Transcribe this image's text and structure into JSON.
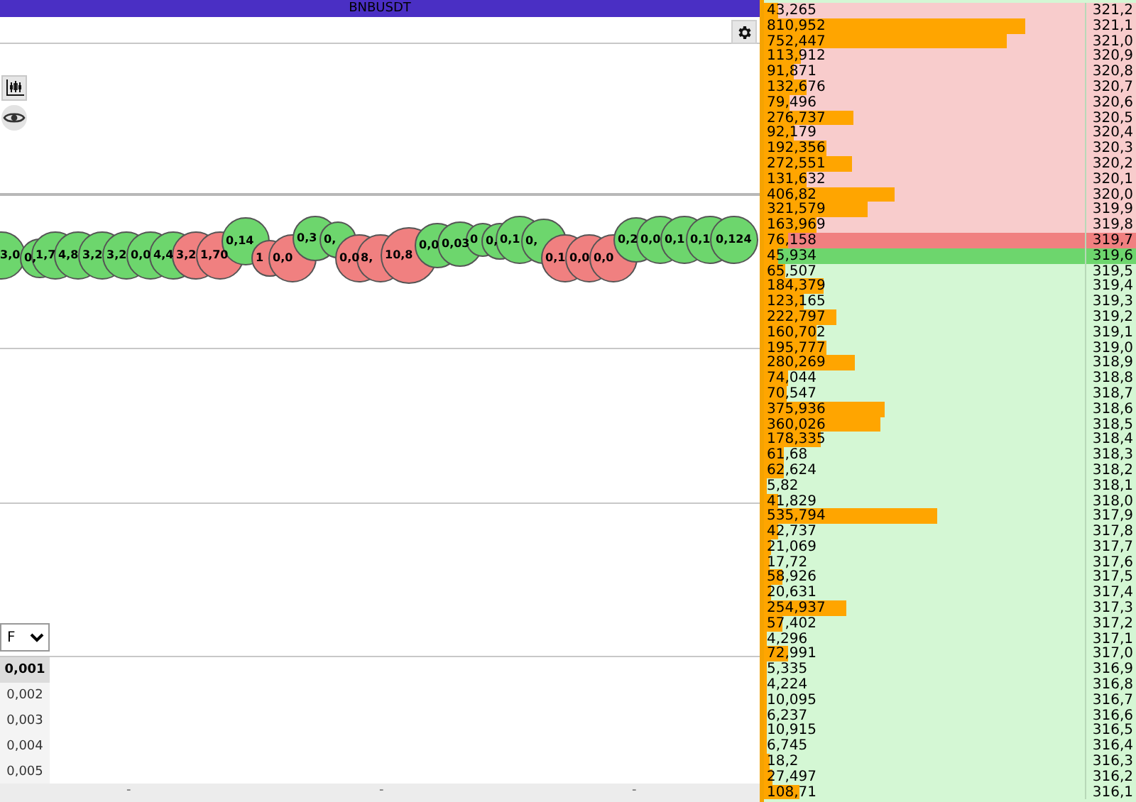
{
  "title": "BNBUSDT",
  "trades": [
    {
      "label": "3,0",
      "kind": "buy"
    },
    {
      "label": "0,",
      "kind": "buy"
    },
    {
      "label": "1,7",
      "kind": "buy"
    },
    {
      "label": "4,8",
      "kind": "buy"
    },
    {
      "label": "3,2",
      "kind": "buy"
    },
    {
      "label": "3,2",
      "kind": "buy"
    },
    {
      "label": "0,0",
      "kind": "buy"
    },
    {
      "label": "4,4",
      "kind": "buy"
    },
    {
      "label": "3,2",
      "kind": "sell"
    },
    {
      "label": "1,70",
      "kind": "sell"
    },
    {
      "label": "0,14",
      "kind": "buy"
    },
    {
      "label": "1",
      "kind": "sell"
    },
    {
      "label": "0,0",
      "kind": "sell"
    },
    {
      "label": "0,3",
      "kind": "buy"
    },
    {
      "label": "0,",
      "kind": "buy"
    },
    {
      "label": "0,0",
      "kind": "sell"
    },
    {
      "label": "8,",
      "kind": "sell"
    },
    {
      "label": "10,8",
      "kind": "sell"
    },
    {
      "label": "0,0",
      "kind": "buy"
    },
    {
      "label": "0,03",
      "kind": "buy"
    },
    {
      "label": "0",
      "kind": "buy"
    },
    {
      "label": "0,",
      "kind": "buy"
    },
    {
      "label": "0,1",
      "kind": "buy"
    },
    {
      "label": "0,",
      "kind": "buy"
    },
    {
      "label": "0,1",
      "kind": "sell"
    },
    {
      "label": "0,0",
      "kind": "sell"
    },
    {
      "label": "0,0",
      "kind": "sell"
    },
    {
      "label": "0,2",
      "kind": "buy"
    },
    {
      "label": "0,0",
      "kind": "buy"
    },
    {
      "label": "0,1",
      "kind": "buy"
    },
    {
      "label": "0,1",
      "kind": "buy"
    },
    {
      "label": "0,124",
      "kind": "buy"
    }
  ],
  "filter": {
    "value": "F"
  },
  "steps": [
    {
      "label": "0,001",
      "selected": true
    },
    {
      "label": "0,002",
      "selected": false
    },
    {
      "label": "0,003",
      "selected": false
    },
    {
      "label": "0,004",
      "selected": false
    },
    {
      "label": "0,005",
      "selected": false
    }
  ],
  "axis_labels": [
    "-",
    "-",
    "-"
  ],
  "order_book": [
    {
      "qty": "43,265",
      "price": "321,2",
      "level": 0.043,
      "kind": "ask"
    },
    {
      "qty": "810,952",
      "price": "321,1",
      "level": 0.811,
      "kind": "ask"
    },
    {
      "qty": "752,447",
      "price": "321,0",
      "level": 0.752,
      "kind": "ask"
    },
    {
      "qty": "113,912",
      "price": "320,9",
      "level": 0.114,
      "kind": "ask"
    },
    {
      "qty": "91,871",
      "price": "320,8",
      "level": 0.092,
      "kind": "ask"
    },
    {
      "qty": "132,676",
      "price": "320,7",
      "level": 0.133,
      "kind": "ask"
    },
    {
      "qty": "79,496",
      "price": "320,6",
      "level": 0.079,
      "kind": "ask"
    },
    {
      "qty": "276,737",
      "price": "320,5",
      "level": 0.277,
      "kind": "ask"
    },
    {
      "qty": "92,179",
      "price": "320,4",
      "level": 0.092,
      "kind": "ask"
    },
    {
      "qty": "192,356",
      "price": "320,3",
      "level": 0.192,
      "kind": "ask"
    },
    {
      "qty": "272,551",
      "price": "320,2",
      "level": 0.273,
      "kind": "ask"
    },
    {
      "qty": "131,632",
      "price": "320,1",
      "level": 0.132,
      "kind": "ask"
    },
    {
      "qty": "406,82",
      "price": "320,0",
      "level": 0.407,
      "kind": "ask"
    },
    {
      "qty": "321,579",
      "price": "319,9",
      "level": 0.322,
      "kind": "ask"
    },
    {
      "qty": "163,969",
      "price": "319,8",
      "level": 0.164,
      "kind": "ask"
    },
    {
      "qty": "76,158",
      "price": "319,7",
      "level": 0.076,
      "kind": "best_ask"
    },
    {
      "qty": "45,934",
      "price": "319,6",
      "level": 0.046,
      "kind": "best_bid"
    },
    {
      "qty": "65,507",
      "price": "319,5",
      "level": 0.066,
      "kind": "bid"
    },
    {
      "qty": "184,379",
      "price": "319,4",
      "level": 0.184,
      "kind": "bid"
    },
    {
      "qty": "123,165",
      "price": "319,3",
      "level": 0.123,
      "kind": "bid"
    },
    {
      "qty": "222,797",
      "price": "319,2",
      "level": 0.223,
      "kind": "bid"
    },
    {
      "qty": "160,702",
      "price": "319,1",
      "level": 0.161,
      "kind": "bid"
    },
    {
      "qty": "195,777",
      "price": "319,0",
      "level": 0.196,
      "kind": "bid"
    },
    {
      "qty": "280,269",
      "price": "318,9",
      "level": 0.28,
      "kind": "bid"
    },
    {
      "qty": "74,044",
      "price": "318,8",
      "level": 0.074,
      "kind": "bid"
    },
    {
      "qty": "70,547",
      "price": "318,7",
      "level": 0.071,
      "kind": "bid"
    },
    {
      "qty": "375,936",
      "price": "318,6",
      "level": 0.376,
      "kind": "bid"
    },
    {
      "qty": "360,026",
      "price": "318,5",
      "level": 0.36,
      "kind": "bid"
    },
    {
      "qty": "178,335",
      "price": "318,4",
      "level": 0.178,
      "kind": "bid"
    },
    {
      "qty": "61,68",
      "price": "318,3",
      "level": 0.062,
      "kind": "bid"
    },
    {
      "qty": "62,624",
      "price": "318,2",
      "level": 0.063,
      "kind": "bid"
    },
    {
      "qty": "5,82",
      "price": "318,1",
      "level": 0.006,
      "kind": "bid"
    },
    {
      "qty": "41,829",
      "price": "318,0",
      "level": 0.042,
      "kind": "bid"
    },
    {
      "qty": "535,794",
      "price": "317,9",
      "level": 0.536,
      "kind": "bid"
    },
    {
      "qty": "42,737",
      "price": "317,8",
      "level": 0.043,
      "kind": "bid"
    },
    {
      "qty": "21,069",
      "price": "317,7",
      "level": 0.021,
      "kind": "bid"
    },
    {
      "qty": "17,72",
      "price": "317,6",
      "level": 0.018,
      "kind": "bid"
    },
    {
      "qty": "58,926",
      "price": "317,5",
      "level": 0.059,
      "kind": "bid"
    },
    {
      "qty": "20,631",
      "price": "317,4",
      "level": 0.021,
      "kind": "bid"
    },
    {
      "qty": "254,937",
      "price": "317,3",
      "level": 0.255,
      "kind": "bid"
    },
    {
      "qty": "57,402",
      "price": "317,2",
      "level": 0.057,
      "kind": "bid"
    },
    {
      "qty": "4,296",
      "price": "317,1",
      "level": 0.004,
      "kind": "bid"
    },
    {
      "qty": "72,991",
      "price": "317,0",
      "level": 0.073,
      "kind": "bid"
    },
    {
      "qty": "5,335",
      "price": "316,9",
      "level": 0.005,
      "kind": "bid"
    },
    {
      "qty": "4,224",
      "price": "316,8",
      "level": 0.004,
      "kind": "bid"
    },
    {
      "qty": "10,095",
      "price": "316,7",
      "level": 0.01,
      "kind": "bid"
    },
    {
      "qty": "6,237",
      "price": "316,6",
      "level": 0.006,
      "kind": "bid"
    },
    {
      "qty": "10,915",
      "price": "316,5",
      "level": 0.011,
      "kind": "bid"
    },
    {
      "qty": "6,745",
      "price": "316,4",
      "level": 0.007,
      "kind": "bid"
    },
    {
      "qty": "18,2",
      "price": "316,3",
      "level": 0.018,
      "kind": "bid"
    },
    {
      "qty": "27,497",
      "price": "316,2",
      "level": 0.027,
      "kind": "bid"
    },
    {
      "qty": "108,71",
      "price": "316,1",
      "level": 0.109,
      "kind": "bid"
    }
  ]
}
